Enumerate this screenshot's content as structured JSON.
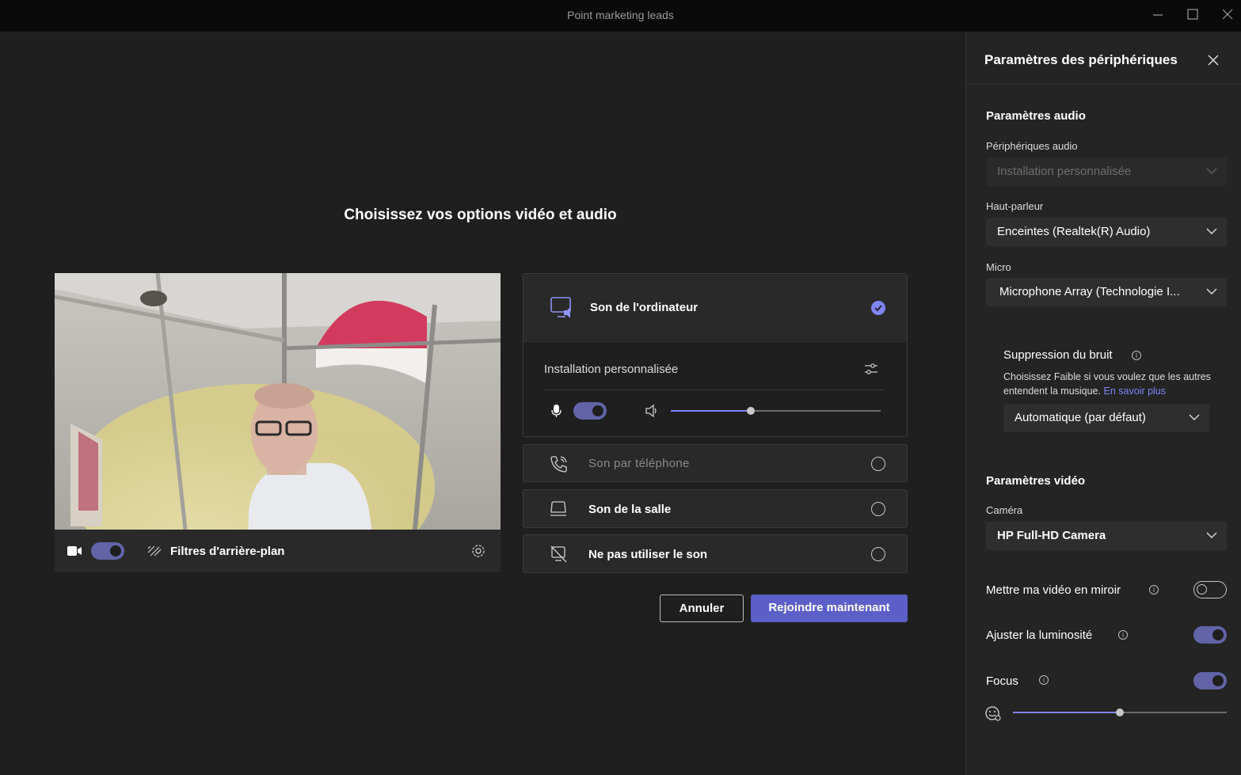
{
  "window": {
    "title": "Point marketing leads"
  },
  "main": {
    "heading": "Choisissez vos options vidéo et audio"
  },
  "video_bar": {
    "camera_on": true,
    "background_filters_label": "Filtres d'arrière-plan"
  },
  "audio_options": {
    "computer": {
      "label": "Son de l'ordinateur",
      "selected": true
    },
    "custom_setup_label": "Installation personnalisée",
    "mic_on": true,
    "speaker_volume": 0.38,
    "phone": {
      "label": "Son par téléphone"
    },
    "room": {
      "label": "Son de la salle"
    },
    "none": {
      "label": "Ne pas utiliser le son"
    }
  },
  "actions": {
    "cancel_label": "Annuler",
    "join_label": "Rejoindre maintenant"
  },
  "colors": {
    "accent": "#6264a7",
    "accent_light": "#7f85f5",
    "panel_bg": "#242424",
    "main_bg": "#1f1f1f",
    "card_bg": "#292929"
  },
  "device_panel": {
    "title": "Paramètres des périphériques",
    "audio_section": "Paramètres audio",
    "audio_devices_label": "Périphériques audio",
    "audio_devices_value": "Installation personnalisée",
    "speaker_label": "Haut-parleur",
    "speaker_value": "Enceintes (Realtek(R) Audio)",
    "mic_label": "Micro",
    "mic_value": "Microphone Array (Technologie I...",
    "noise_title": "Suppression du bruit",
    "noise_desc": "Choisissez Faible si vous voulez que les autres entendent la musique.",
    "noise_link": "En savoir plus",
    "noise_value": "Automatique (par défaut)",
    "video_section": "Paramètres vidéo",
    "camera_label": "Caméra",
    "camera_value": "HP Full-HD Camera",
    "mirror_label": "Mettre ma vidéo en miroir",
    "mirror_on": false,
    "brightness_label": "Ajuster la luminosité",
    "brightness_on": true,
    "focus_label": "Focus",
    "focus_on": true,
    "focus_level": 0.5
  }
}
